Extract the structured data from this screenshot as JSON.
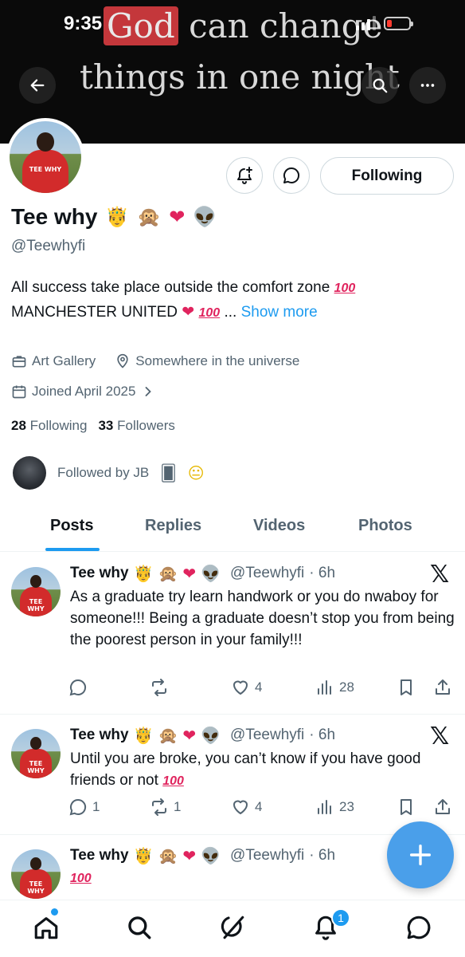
{
  "status_bar": {
    "time": "9:35"
  },
  "banner": {
    "line1_highlight": "God",
    "line1_rest": "can change",
    "line2": "things in one night"
  },
  "profile": {
    "name": "Tee why",
    "name_emojis": [
      "🤴",
      "🙊",
      "❤",
      "👽"
    ],
    "handle": "@Teewhyfi",
    "avatar_text": "TEE WHY",
    "bio_line1": "All success take place outside the comfort zone",
    "bio_line2": "MANCHESTER UNITED",
    "bio_hundred": "100",
    "bio_ellipsis": "...",
    "show_more": "Show more",
    "category": "Art Gallery",
    "location": "Somewhere in the universe",
    "joined": "Joined April 2025",
    "following_count": "28",
    "following_label": "Following",
    "followers_count": "33",
    "followers_label": "Followers",
    "followed_by": "Followed by JB",
    "following_button": "Following"
  },
  "tabs": [
    "Posts",
    "Replies",
    "Videos",
    "Photos"
  ],
  "posts": [
    {
      "name": "Tee why",
      "handle": "@Teewhyfi",
      "time": "· 6h",
      "text": "As a graduate try learn handwork or you do nwaboy for someone!!! Being a graduate doesn’t stop you from being the poorest person in your family!!!",
      "hundred": "",
      "replies": "",
      "reposts": "",
      "likes": "4",
      "views": "28"
    },
    {
      "name": "Tee why",
      "handle": "@Teewhyfi",
      "time": "· 6h",
      "text": "Until you are broke, you can’t know if you have good friends or not",
      "hundred": "100",
      "replies": "1",
      "reposts": "1",
      "likes": "4",
      "views": "23"
    },
    {
      "name": "Tee why",
      "handle": "@Teewhyfi",
      "time": "· 6h",
      "text": "",
      "hundred": "100"
    }
  ],
  "notifications_badge": "1",
  "icons": {
    "back": "back-arrow-icon",
    "search": "search-icon",
    "more": "more-icon",
    "notify": "notification-plus-icon",
    "message": "message-icon",
    "briefcase": "briefcase-icon",
    "location": "location-pin-icon",
    "calendar": "calendar-icon",
    "reply": "reply-icon",
    "repost": "repost-icon",
    "like": "heart-icon",
    "views": "views-icon",
    "bookmark": "bookmark-icon",
    "share": "share-icon",
    "x": "x-logo-icon",
    "home": "home-icon",
    "explore": "search-icon",
    "grok": "grok-icon",
    "bell": "bell-icon",
    "chat": "chat-icon"
  },
  "colors": {
    "accent": "#1d9bf0",
    "heart": "#e0245e",
    "text": "#0f1419",
    "secondary": "#536471"
  }
}
